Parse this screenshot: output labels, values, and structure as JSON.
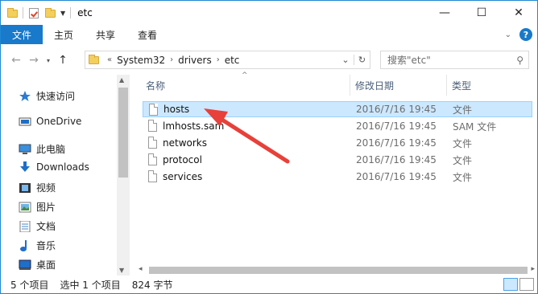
{
  "window": {
    "title": "etc",
    "minimize_glyph": "—",
    "maximize_glyph": "☐",
    "close_glyph": "✕"
  },
  "ribbon": {
    "tabs": [
      "文件",
      "主页",
      "共享",
      "查看"
    ],
    "accent": "#1979ca",
    "help_glyph": "?"
  },
  "nav": {
    "back_glyph": "←",
    "forward_glyph": "→",
    "recent_glyph": "▾",
    "up_glyph": "↑",
    "overflow_glyph": "«",
    "crumbs": [
      "System32",
      "drivers",
      "etc"
    ],
    "crumb_sep": "›",
    "dropdown_glyph": "⌄",
    "refresh_glyph": "↻",
    "search_placeholder": "搜索\"etc\"",
    "search_icon": "⚲"
  },
  "sidebar": {
    "items": [
      {
        "label": "快速访问",
        "icon": "star-icon"
      },
      {
        "label": "OneDrive",
        "icon": "cloud-icon"
      },
      {
        "label": "此电脑",
        "icon": "computer-icon"
      },
      {
        "label": "Downloads",
        "icon": "download-icon"
      },
      {
        "label": "视频",
        "icon": "video-icon"
      },
      {
        "label": "图片",
        "icon": "picture-icon"
      },
      {
        "label": "文档",
        "icon": "document-icon"
      },
      {
        "label": "音乐",
        "icon": "music-icon"
      },
      {
        "label": "桌面",
        "icon": "desktop-icon"
      }
    ]
  },
  "filelist": {
    "columns": [
      "名称",
      "修改日期",
      "类型"
    ],
    "rows": [
      {
        "name": "hosts",
        "date": "2016/7/16 19:45",
        "type": "文件",
        "selected": true
      },
      {
        "name": "lmhosts.sam",
        "date": "2016/7/16 19:45",
        "type": "SAM 文件",
        "selected": false
      },
      {
        "name": "networks",
        "date": "2016/7/16 19:45",
        "type": "文件",
        "selected": false
      },
      {
        "name": "protocol",
        "date": "2016/7/16 19:45",
        "type": "文件",
        "selected": false
      },
      {
        "name": "services",
        "date": "2016/7/16 19:45",
        "type": "文件",
        "selected": false
      }
    ],
    "selection_color": "#cce8ff"
  },
  "statusbar": {
    "count": "5 个项目",
    "selected": "选中 1 个项目",
    "size": "824 字节"
  },
  "annotation": {
    "arrow_color": "#e8403a"
  }
}
